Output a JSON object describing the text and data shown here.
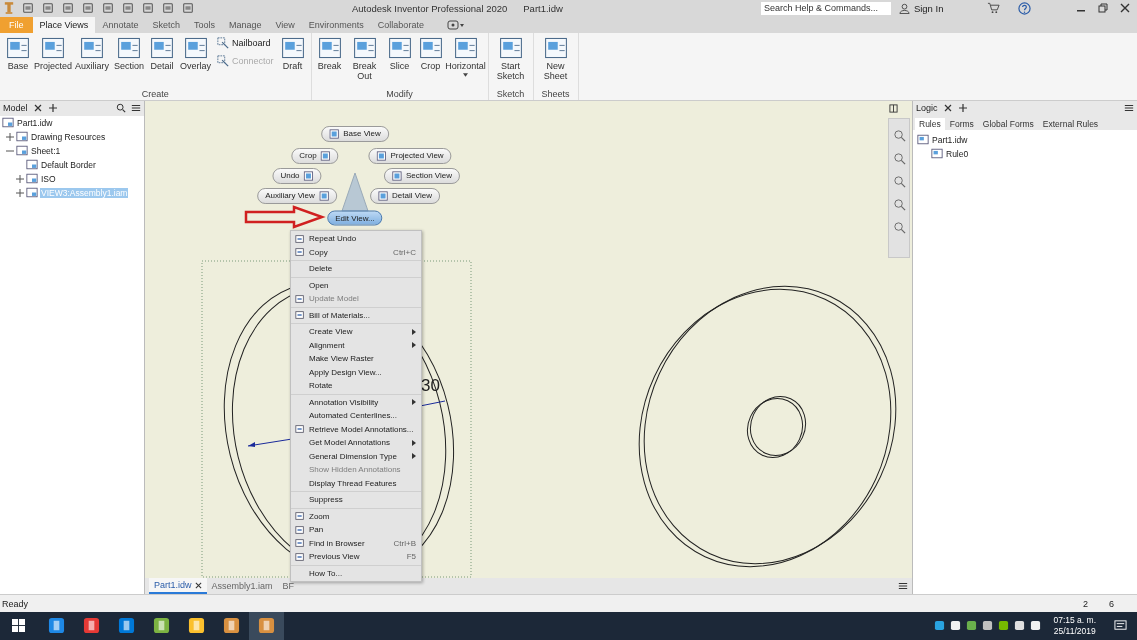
{
  "title_bar": {
    "app_title": "Autodesk Inventor Professional 2020",
    "document": "Part1.idw",
    "search": {
      "placeholder": "Search Help & Commands..."
    },
    "sign_in": "Sign In"
  },
  "ribbon_tabs": [
    {
      "label": "File",
      "kind": "file",
      "selected": false
    },
    {
      "label": "Place Views",
      "kind": "tab",
      "selected": true
    },
    {
      "label": "Annotate",
      "kind": "tab",
      "selected": false
    },
    {
      "label": "Sketch",
      "kind": "tab",
      "selected": false
    },
    {
      "label": "Tools",
      "kind": "tab",
      "selected": false
    },
    {
      "label": "Manage",
      "kind": "tab",
      "selected": false
    },
    {
      "label": "View",
      "kind": "tab",
      "selected": false
    },
    {
      "label": "Environments",
      "kind": "tab",
      "selected": false
    },
    {
      "label": "Collaborate",
      "kind": "tab",
      "selected": false
    }
  ],
  "ribbon_panels": [
    {
      "title": "Create",
      "tools": [
        {
          "label": "Base",
          "kind": "large",
          "disabled": false
        },
        {
          "label": "Projected",
          "kind": "large",
          "disabled": false
        },
        {
          "label": "Auxiliary",
          "kind": "large",
          "disabled": false
        },
        {
          "label": "Section",
          "kind": "large",
          "disabled": false
        },
        {
          "label": "Detail",
          "kind": "large",
          "disabled": false
        },
        {
          "label": "Overlay",
          "kind": "large",
          "disabled": false
        },
        {
          "label": "Nailboard",
          "kind": "small",
          "disabled": false
        },
        {
          "label": "Connector",
          "kind": "small",
          "disabled": true
        },
        {
          "label": "Draft",
          "kind": "large",
          "disabled": false
        }
      ]
    },
    {
      "title": "Modify",
      "tools": [
        {
          "label": "Break",
          "kind": "large",
          "disabled": false
        },
        {
          "label": "Break Out",
          "kind": "large",
          "disabled": false
        },
        {
          "label": "Slice",
          "kind": "large",
          "disabled": false
        },
        {
          "label": "Crop",
          "kind": "large",
          "disabled": false
        },
        {
          "label": "Horizontal",
          "kind": "dropdown",
          "disabled": false
        }
      ]
    },
    {
      "title": "Sketch",
      "tools": [
        {
          "label": "Start Sketch",
          "kind": "large",
          "disabled": false
        }
      ]
    },
    {
      "title": "Sheets",
      "tools": [
        {
          "label": "New Sheet",
          "kind": "large",
          "disabled": false
        }
      ]
    }
  ],
  "browser": {
    "title": "Model",
    "tree": [
      {
        "label": "Part1.idw",
        "selected": false,
        "children": [
          {
            "label": "Drawing Resources",
            "expanded": false,
            "selected": false
          },
          {
            "label": "Sheet:1",
            "expanded": true,
            "selected": false,
            "children": [
              {
                "label": "Default Border",
                "selected": false
              },
              {
                "label": "ISO",
                "expanded": false,
                "selected": false
              },
              {
                "label": "VIEW3:Assembly1.iam",
                "expanded": false,
                "selected": true
              }
            ]
          }
        ]
      }
    ]
  },
  "marking_menu": [
    {
      "label": "Base View",
      "kind": "icon-before",
      "selected": false
    },
    {
      "label": "Crop",
      "kind": "icon-after",
      "selected": false
    },
    {
      "label": "Projected View",
      "kind": "icon-before",
      "selected": false
    },
    {
      "label": "Undo",
      "kind": "icon-after",
      "selected": false
    },
    {
      "label": "Section View",
      "kind": "icon-before",
      "selected": false
    },
    {
      "label": "Auxiliary View",
      "kind": "icon-after",
      "selected": false
    },
    {
      "label": "Detail View",
      "kind": "icon-before",
      "selected": false
    },
    {
      "label": "Edit View...",
      "kind": "text",
      "selected": true
    }
  ],
  "context_menu": [
    [
      {
        "label": "Repeat Undo",
        "kind": "icon",
        "disabled": false,
        "submenu": false
      },
      {
        "label": "Copy",
        "shortcut": "Ctrl+C",
        "kind": "icon",
        "disabled": false,
        "submenu": false
      }
    ],
    [
      {
        "label": "Delete",
        "kind": "text",
        "disabled": false,
        "submenu": false
      }
    ],
    [
      {
        "label": "Open",
        "kind": "text",
        "disabled": false,
        "submenu": false
      },
      {
        "label": "Update Model",
        "kind": "icon",
        "disabled": true,
        "submenu": false
      }
    ],
    [
      {
        "label": "Bill of Materials...",
        "kind": "icon",
        "disabled": false,
        "submenu": false
      }
    ],
    [
      {
        "label": "Create View",
        "kind": "text",
        "disabled": false,
        "submenu": true
      },
      {
        "label": "Alignment",
        "kind": "text",
        "disabled": false,
        "submenu": true
      },
      {
        "label": "Make View Raster",
        "kind": "text",
        "disabled": false,
        "submenu": false
      },
      {
        "label": "Apply Design View...",
        "kind": "text",
        "disabled": false,
        "submenu": false
      },
      {
        "label": "Rotate",
        "kind": "text",
        "disabled": false,
        "submenu": false
      }
    ],
    [
      {
        "label": "Annotation Visibility",
        "kind": "text",
        "disabled": false,
        "submenu": true
      },
      {
        "label": "Automated Centerlines...",
        "kind": "text",
        "disabled": false,
        "submenu": false
      },
      {
        "label": "Retrieve Model Annotations...",
        "kind": "icon",
        "disabled": false,
        "submenu": false
      },
      {
        "label": "Get Model Annotations",
        "kind": "text",
        "disabled": false,
        "submenu": true
      },
      {
        "label": "General Dimension Type",
        "kind": "text",
        "disabled": false,
        "submenu": true
      },
      {
        "label": "Show Hidden Annotations",
        "kind": "text",
        "disabled": true,
        "submenu": false
      },
      {
        "label": "Display Thread Features",
        "kind": "text",
        "disabled": false,
        "submenu": false
      }
    ],
    [
      {
        "label": "Suppress",
        "kind": "text",
        "disabled": false,
        "submenu": false
      }
    ],
    [
      {
        "label": "Zoom",
        "kind": "icon",
        "disabled": false,
        "submenu": false
      },
      {
        "label": "Pan",
        "kind": "icon",
        "disabled": false,
        "submenu": false
      },
      {
        "label": "Find in Browser",
        "shortcut": "Ctrl+B",
        "kind": "icon",
        "disabled": false,
        "submenu": false
      },
      {
        "label": "Previous View",
        "shortcut": "F5",
        "kind": "icon",
        "disabled": false,
        "submenu": false
      }
    ],
    [
      {
        "label": "How To...",
        "kind": "text",
        "disabled": false,
        "submenu": false
      }
    ]
  ],
  "drawing": {
    "dimension": "30"
  },
  "document_tabs": [
    {
      "label": "Part1.idw",
      "selected": true
    },
    {
      "label": "Assembly1.iam",
      "selected": false
    },
    {
      "label": "BF",
      "selected": false
    }
  ],
  "logic_panel": {
    "title": "Logic",
    "tabs": [
      {
        "label": "Rules",
        "selected": true
      },
      {
        "label": "Forms",
        "selected": false
      },
      {
        "label": "Global Forms",
        "selected": false
      },
      {
        "label": "External Rules",
        "selected": false
      }
    ],
    "tree": [
      {
        "label": "Part1.idw",
        "children": [
          {
            "label": "Rule0"
          }
        ]
      }
    ]
  },
  "status_bar": {
    "text": "Ready",
    "values": [
      "2",
      "6"
    ]
  },
  "taskbar": {
    "time": "07:15 a. m.",
    "date": "25/11/2019"
  }
}
